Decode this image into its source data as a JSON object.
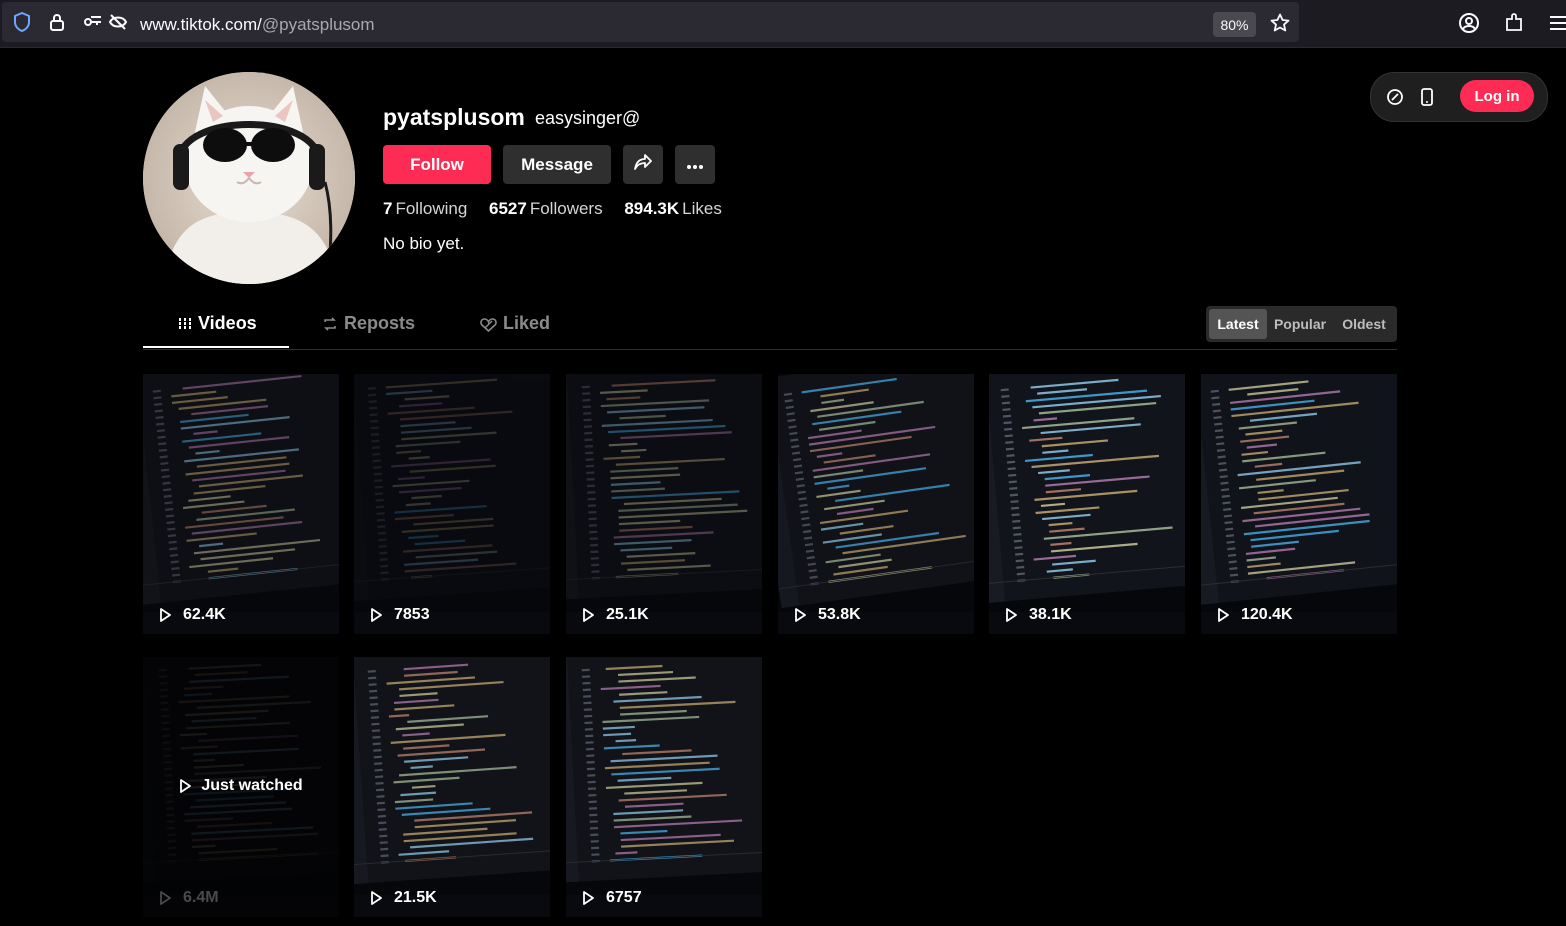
{
  "browser": {
    "url_host": "www.tiktok.com/",
    "url_path": "@pyatsplusom",
    "zoom": "80%"
  },
  "top_actions": {
    "login_label": "Log in"
  },
  "profile": {
    "username": "pyatsplusom",
    "nickname": "easysinger@",
    "follow_label": "Follow",
    "message_label": "Message",
    "stats": {
      "following_count": "7",
      "following_label": "Following",
      "followers_count": "6527",
      "followers_label": "Followers",
      "likes_count": "894.3K",
      "likes_label": "Likes"
    },
    "bio": "No bio yet."
  },
  "tabs": [
    {
      "label": "Videos",
      "icon": "grid-icon",
      "active": true
    },
    {
      "label": "Reposts",
      "icon": "repost-icon",
      "active": false
    },
    {
      "label": "Liked",
      "icon": "liked-heart-icon",
      "active": false
    }
  ],
  "sort": [
    {
      "label": "Latest",
      "active": true
    },
    {
      "label": "Popular",
      "active": false
    },
    {
      "label": "Oldest",
      "active": false
    }
  ],
  "videos": [
    {
      "views": "62.4K"
    },
    {
      "views": "7853"
    },
    {
      "views": "25.1K"
    },
    {
      "views": "53.8K"
    },
    {
      "views": "38.1K"
    },
    {
      "views": "120.4K"
    },
    {
      "views": "6.4M",
      "overlay": "Just watched"
    },
    {
      "views": "21.5K"
    },
    {
      "views": "6757"
    }
  ],
  "colors": {
    "accent": "#fe2c55",
    "background": "#000000",
    "browser_chrome": "#1c1b22"
  }
}
